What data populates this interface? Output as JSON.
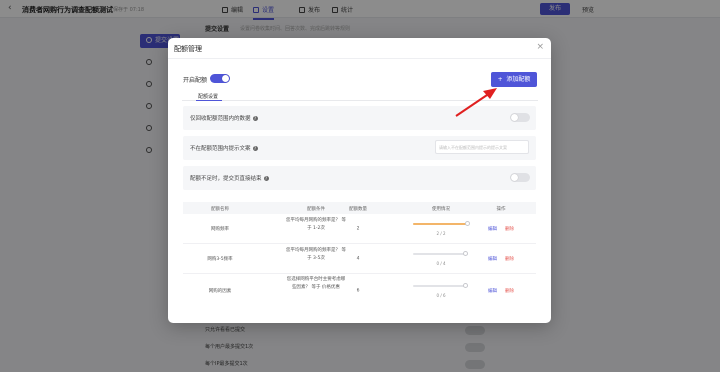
{
  "app": {
    "title": "消费者网购行为调查配额测试",
    "saved_time": "保存于 07:18",
    "nav": [
      {
        "label": "编辑",
        "active": false
      },
      {
        "label": "设置",
        "active": true
      },
      {
        "label": "发布",
        "active": false
      },
      {
        "label": "统计",
        "active": false
      }
    ],
    "publish_label": "发布",
    "preview_label": "预览"
  },
  "background": {
    "sidebar_active": "提交设置",
    "sidebar_items": [
      "",
      "",
      "",
      "",
      ""
    ],
    "section_title": "提交设置",
    "section_tip": "设置问卷收集时间、回答次数、完成后跳转等规则",
    "rows": [
      "只允许看看已提交",
      "每个用户最多提交1次",
      "每个IP最多提交1次"
    ]
  },
  "modal": {
    "title": "配额管理",
    "close_icon": "×",
    "enable_label": "开启配额",
    "enable_on": true,
    "add_button": "添加配额",
    "add_icon": "+",
    "tab_label": "配额设置",
    "settings": [
      {
        "label": "仅回收配额范围内的数据",
        "type": "toggle",
        "on": false
      },
      {
        "label": "不在配额范围内提示文案",
        "type": "input",
        "placeholder": "请输入不在配额范围内提示的提示文案"
      },
      {
        "label": "配额不足时，提交页直接结束",
        "type": "toggle",
        "on": false
      }
    ],
    "table": {
      "headers": [
        "配额名称",
        "配额条件",
        "配额数量",
        "使用情况",
        "操作"
      ],
      "rows": [
        {
          "name": "网购频率",
          "condition": "您平均每月网购的频率是？ 等于 1-2次",
          "count": "2",
          "usage": "2 / 2",
          "progress": 1.0,
          "edit": "编辑",
          "delete": "删除"
        },
        {
          "name": "网购3-5频率",
          "condition": "您平均每月网购的频率是？ 等于 3-5次",
          "count": "4",
          "usage": "0 / 4",
          "progress": 0.0,
          "edit": "编辑",
          "delete": "删除"
        },
        {
          "name": "网购的因素",
          "condition": "您选择网购平台时主要考虑哪些因素？ 等于 价格优惠",
          "count": "6",
          "usage": "0 / 6",
          "progress": 0.0,
          "edit": "编辑",
          "delete": "删除"
        }
      ]
    }
  },
  "colors": {
    "accent": "#4f55d8",
    "danger": "#e5554f",
    "progress": "#f3b569",
    "arrow": "#e02020"
  }
}
